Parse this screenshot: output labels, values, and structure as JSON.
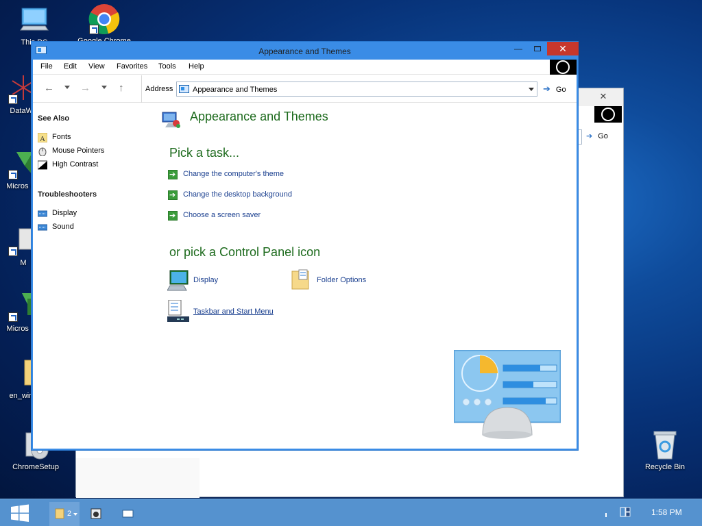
{
  "desktop": {
    "icons": [
      {
        "label": "This PC"
      },
      {
        "label": "Google Chrome"
      },
      {
        "label": "DataWa"
      },
      {
        "label": "Micros C+"
      },
      {
        "label": "M"
      },
      {
        "label": "Micros Ba"
      },
      {
        "label": "en_wind"
      },
      {
        "label": "ChromeSetup"
      },
      {
        "label": "Recycle Bin"
      }
    ]
  },
  "background_window": {
    "close_glyph": "✕",
    "go_label": "Go"
  },
  "window": {
    "title": "Appearance and Themes",
    "controls": {
      "minimize": "—",
      "close": "✕"
    },
    "menu": [
      "File",
      "Edit",
      "View",
      "Favorites",
      "Tools",
      "Help"
    ],
    "nav": {
      "back": "←",
      "forward": "→",
      "up": "↑"
    },
    "address": {
      "label": "Address",
      "value": "Appearance and Themes",
      "go_label": "Go"
    },
    "see_also": {
      "heading": "See Also",
      "items": [
        {
          "label": "Fonts",
          "icon": "fonts-icon"
        },
        {
          "label": "Mouse Pointers",
          "icon": "mouse-icon"
        },
        {
          "label": "High Contrast",
          "icon": "contrast-icon"
        }
      ]
    },
    "troubleshooters": {
      "heading": "Troubleshooters",
      "items": [
        {
          "label": "Display",
          "icon": "display-troubleshooter-icon"
        },
        {
          "label": "Sound",
          "icon": "sound-troubleshooter-icon"
        }
      ]
    },
    "content": {
      "title": "Appearance and Themes",
      "pick_task": "Pick a task...",
      "tasks": [
        {
          "label": "Change the computer's theme"
        },
        {
          "label": "Change the desktop background"
        },
        {
          "label": "Choose a screen saver"
        }
      ],
      "pick_icon": "or pick a Control Panel icon",
      "icons": [
        {
          "label": "Display"
        },
        {
          "label": "Folder Options"
        },
        {
          "label": "Taskbar and Start Menu"
        }
      ]
    }
  },
  "taskbar": {
    "explorer_count": "2",
    "clock": "1:58 PM"
  },
  "colors": {
    "window_border": "#3a8ce6",
    "heading_green": "#1e6b1e",
    "link_blue": "#1a3f8f",
    "close_red": "#c7372c",
    "taskbar": "#5592cf"
  }
}
